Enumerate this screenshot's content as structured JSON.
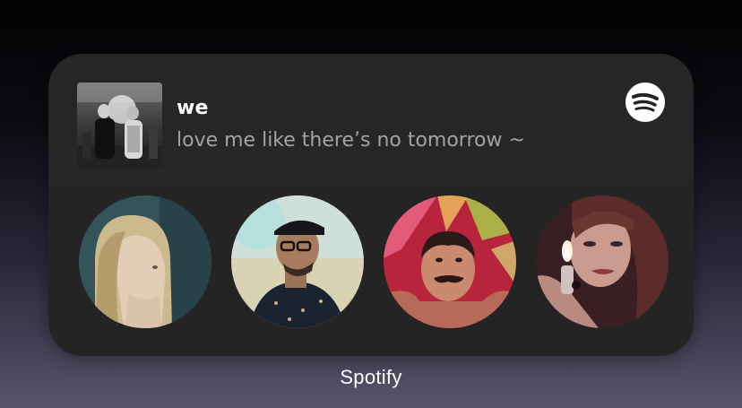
{
  "widget": {
    "now_playing": {
      "title": "we",
      "subtitle": "love me like there’s no tomorrow ~",
      "album_art_icon": "album-art-black-and-white-couple"
    },
    "brand_icon": "spotify-icon",
    "brand_color": "#ffffff",
    "artists": [
      {
        "icon": "artist-photo-blonde-woman",
        "accent": "#2f4f55"
      },
      {
        "icon": "artist-photo-man-with-glasses-and-cap",
        "accent": "#c9c6a8"
      },
      {
        "icon": "artist-photo-mustached-man-red",
        "accent": "#c8324a"
      },
      {
        "icon": "artist-photo-woman-with-lighter",
        "accent": "#5a2b2e"
      }
    ]
  },
  "app_label": "Spotify"
}
